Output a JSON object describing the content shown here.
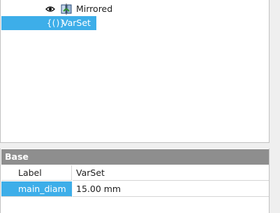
{
  "tree": {
    "items": [
      {
        "label": "Mirrored",
        "icon": "mirrored-feature-icon",
        "visibility_icon": "eye-icon"
      },
      {
        "label": "VarSet",
        "icon_glyph": "{()}",
        "icon": "varset-icon",
        "selected": true
      }
    ]
  },
  "properties": {
    "group": "Base",
    "rows": [
      {
        "name": "Label",
        "value": "VarSet"
      },
      {
        "name": "main_diam",
        "value": "15.00 mm",
        "selected": true
      }
    ]
  },
  "colors": {
    "selection": "#3daee9",
    "group_header": "#8e8e8e"
  }
}
